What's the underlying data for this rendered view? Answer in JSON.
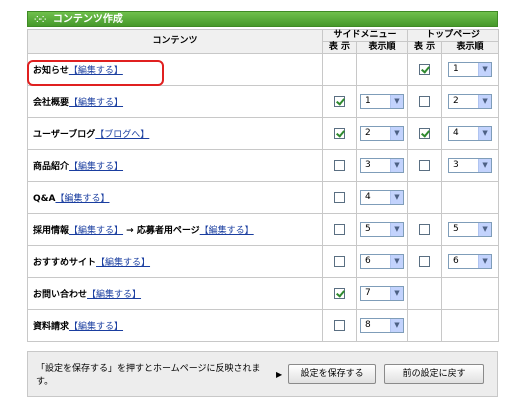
{
  "panel": {
    "title": "コンテンツ作成",
    "title_icon": "dots-icon"
  },
  "headers": {
    "contents": "コンテンツ",
    "side_menu": "サイドメニュー",
    "top_page": "トップページ",
    "show": "表 示",
    "order": "表示順"
  },
  "rows": [
    {
      "name": "お知らせ",
      "link": "【編集する】",
      "extra": "",
      "extra_link": "",
      "side_show": null,
      "side_order": null,
      "top_show": true,
      "top_order": "1"
    },
    {
      "name": "会社概要",
      "link": "【編集する】",
      "extra": "",
      "extra_link": "",
      "side_show": true,
      "side_order": "1",
      "top_show": false,
      "top_order": "2"
    },
    {
      "name": "ユーザーブログ",
      "link": "【ブログへ】",
      "extra": "",
      "extra_link": "",
      "side_show": true,
      "side_order": "2",
      "top_show": true,
      "top_order": "4"
    },
    {
      "name": "商品紹介",
      "link": "【編集する】",
      "extra": "",
      "extra_link": "",
      "side_show": false,
      "side_order": "3",
      "top_show": false,
      "top_order": "3"
    },
    {
      "name": "Q&A",
      "link": "【編集する】",
      "extra": "",
      "extra_link": "",
      "side_show": false,
      "side_order": "4",
      "top_show": null,
      "top_order": null
    },
    {
      "name": "採用情報",
      "link": "【編集する】",
      "extra": " → 応募者用ページ",
      "extra_link": "【編集する】",
      "side_show": false,
      "side_order": "5",
      "top_show": false,
      "top_order": "5"
    },
    {
      "name": "おすすめサイト",
      "link": "【編集する】",
      "extra": "",
      "extra_link": "",
      "side_show": false,
      "side_order": "6",
      "top_show": false,
      "top_order": "6"
    },
    {
      "name": "お問い合わせ",
      "link": "【編集する】",
      "extra": "",
      "extra_link": "",
      "side_show": true,
      "side_order": "7",
      "top_show": null,
      "top_order": null
    },
    {
      "name": "資料請求",
      "link": "【編集する】",
      "extra": "",
      "extra_link": "",
      "side_show": false,
      "side_order": "8",
      "top_show": null,
      "top_order": null
    }
  ],
  "footer": {
    "message": "「設定を保存する」を押すとホームページに反映されます。",
    "arrow": "▶",
    "save_label": "設定を保存する",
    "revert_label": "前の設定に戻す"
  },
  "colors": {
    "title_bar": "#46992a",
    "highlight": "#e02020",
    "link": "#1a3ea0"
  }
}
